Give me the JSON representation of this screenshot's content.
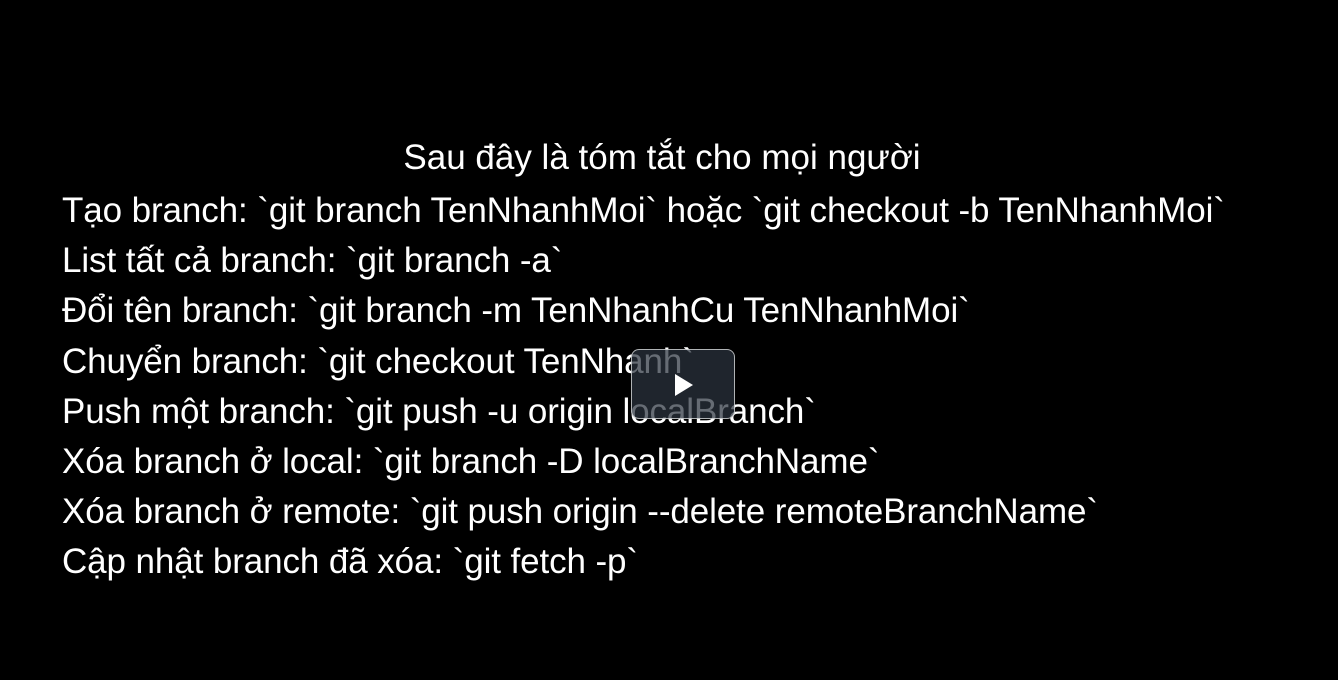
{
  "player": {
    "play_icon": "play-icon",
    "background_color": "#000000",
    "text_color": "#ffffff",
    "play_button_color": "#2b333f"
  },
  "content": {
    "title": "Sau đây là tóm tắt cho mọi người",
    "lines": [
      "Tạo branch: `git branch TenNhanhMoi` hoặc `git checkout -b TenNhanhMoi`",
      "List tất cả branch: `git branch -a`",
      "Đổi tên branch: `git branch -m TenNhanhCu TenNhanhMoi`",
      "Chuyển branch: `git checkout TenNhanh`",
      "Push một branch: `git push -u origin localBranch`",
      "Xóa branch ở local: `git branch -D localBranchName`",
      "Xóa branch ở remote: `git push origin --delete remoteBranchName`",
      "Cập nhật branch đã xóa: `git fetch -p`"
    ]
  }
}
